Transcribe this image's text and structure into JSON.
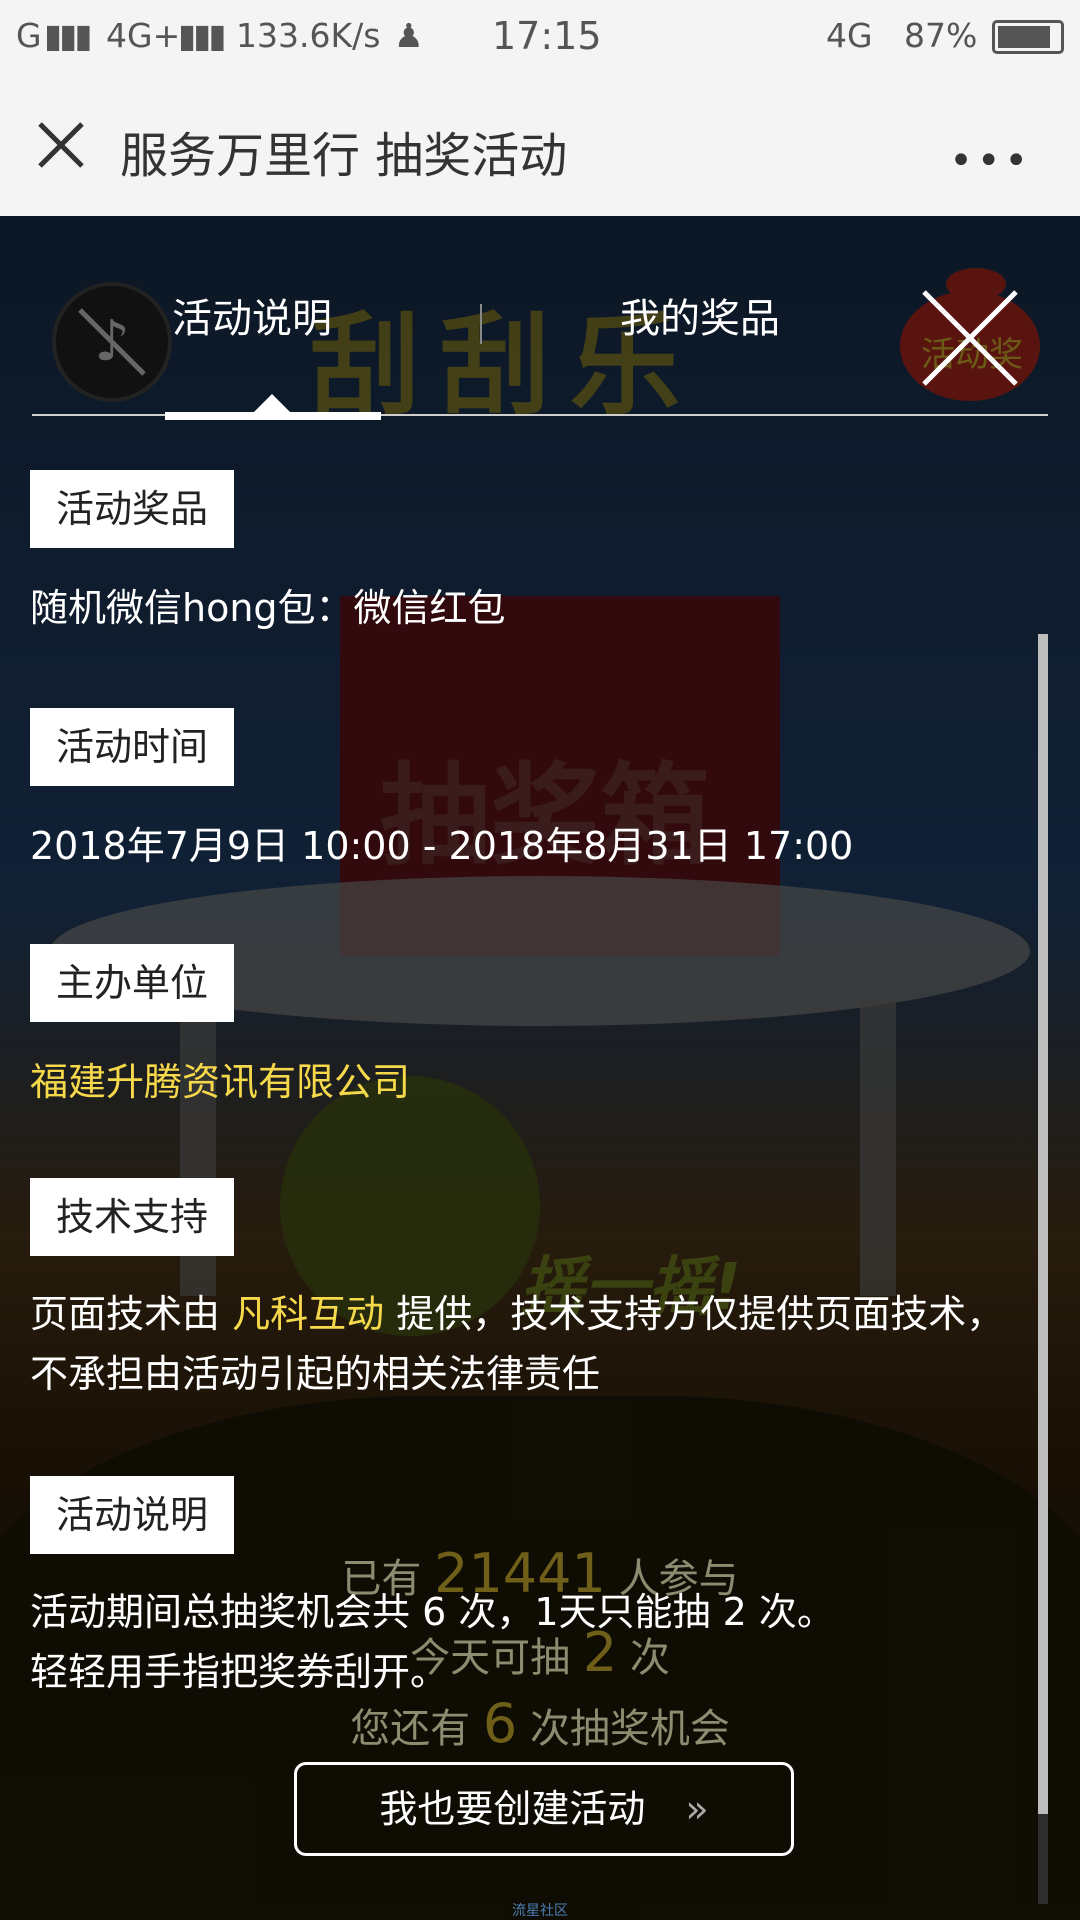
{
  "status_bar": {
    "carrier": "G",
    "network": "4G+",
    "speed": "133.6K/s",
    "time": "17:15",
    "network2": "4G",
    "battery": "87%"
  },
  "nav": {
    "title": "服务万里行 抽奖活动",
    "more": "•••"
  },
  "tabs": [
    {
      "label": "活动说明"
    },
    {
      "label": "我的奖品"
    }
  ],
  "sections": [
    {
      "label": "活动奖品",
      "text": "随机微信hong包：微信红包"
    },
    {
      "label": "活动时间",
      "text": "2018年7月9日 10:00 - 2018年8月31日 17:00"
    },
    {
      "label": "主办单位",
      "text": "福建升腾资讯有限公司"
    },
    {
      "label": "技术支持",
      "text_pre": "页面技术由 ",
      "highlight": "凡科互动",
      "text_post": " 提供，技术支持方仅提供页面技术，不承担由活动引起的相关法律责任"
    },
    {
      "label": "活动说明",
      "line1": "活动期间总抽奖机会共 6 次，1天只能抽 2 次。",
      "line2": "轻轻用手指把奖券刮开。"
    }
  ],
  "background": {
    "banner": "刮刮乐",
    "box_label": "抽奖箱",
    "shake_text": "摇一摇!",
    "bag_text": "活动奖"
  },
  "participants": {
    "line1_pre": "已有 ",
    "count": "21441",
    "line1_post": " 人参与",
    "line2_pre": "今天可抽 ",
    "today": "2",
    "line2_post": " 次",
    "line3_pre": "您还有 ",
    "remaining": "6",
    "line3_post": " 次抽奖机会"
  },
  "cta": {
    "label": "我也要创建活动",
    "arrow": "»"
  },
  "footer": {
    "text": "流星社区"
  }
}
